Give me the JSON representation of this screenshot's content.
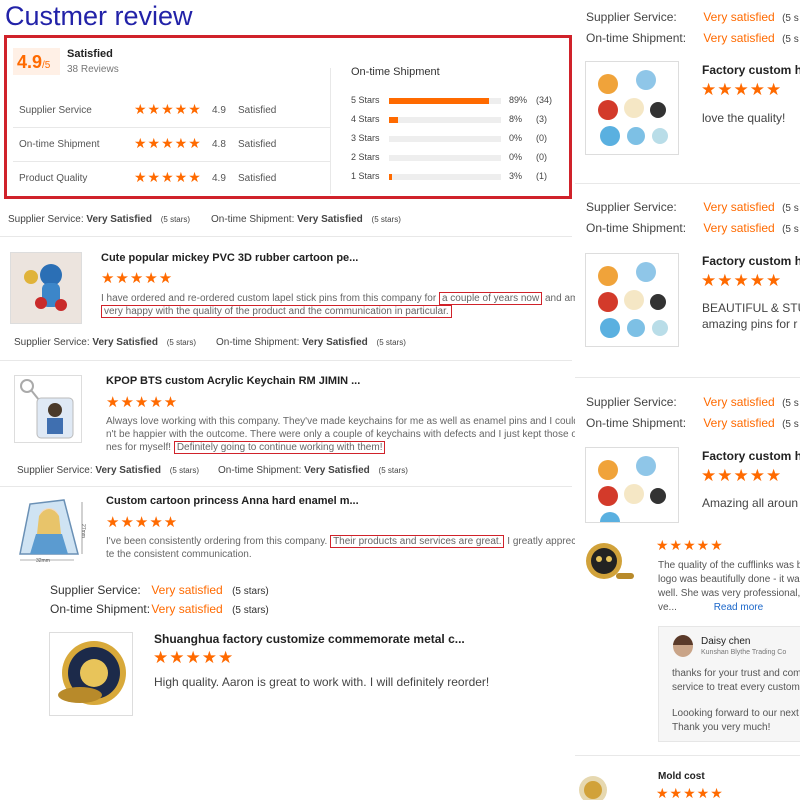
{
  "title": "Custmer review",
  "summary": {
    "score": "4.9",
    "score_suffix": "/5",
    "rating_word": "Satisfied",
    "reviews_count": "38 Reviews",
    "rows": [
      {
        "label": "Supplier Service",
        "stars": "★★★★★",
        "value": "4.9",
        "word": "Satisfied"
      },
      {
        "label": "On-time Shipment",
        "stars": "★★★★★",
        "value": "4.8",
        "word": "Satisfied"
      },
      {
        "label": "Product Quality",
        "stars": "★★★★★",
        "value": "4.9",
        "word": "Satisfied"
      }
    ],
    "dist_title": "On-time Shipment",
    "dist": [
      {
        "label": "5 Stars",
        "fraction": 0.89,
        "pct": "89%",
        "count": "(34)"
      },
      {
        "label": "4 Stars",
        "fraction": 0.08,
        "pct": "8%",
        "count": "(3)"
      },
      {
        "label": "3 Stars",
        "fraction": 0,
        "pct": "0%",
        "count": "(0)"
      },
      {
        "label": "2 Stars",
        "fraction": 0,
        "pct": "0%",
        "count": "(0)"
      },
      {
        "label": "1 Stars",
        "fraction": 0.03,
        "pct": "3%",
        "count": "(1)"
      }
    ]
  },
  "meta_small": {
    "supplier_label": "Supplier Service:",
    "supplier_value": "Very Satisfied",
    "shipment_label": "On-time Shipment:",
    "shipment_value": "Very Satisfied",
    "stars_note": "(5 stars)"
  },
  "stars5": "★★★★★",
  "reviews": [
    {
      "title": "Cute popular mickey PVC 3D rubber cartoon pe...",
      "text_a": "I have ordered and re-ordered custom lapel stick pins from this company for",
      "hl1": "a couple of years now",
      "text_b": "and am",
      "hl2": "very happy with the quality of the product and the communication in particular."
    },
    {
      "title": "KPOP BTS custom Acrylic Keychain RM JIMIN ...",
      "text_a": "Always love working with this company. They've made keychains for me as well as enamel pins and I could",
      "text_b": "n't be happier with the outcome. There were only a couple of keychains with defects and I just kept those o",
      "text_c": "nes for myself!",
      "hl1": "Definitely going to continue working with them!"
    },
    {
      "title": "Custom cartoon princess Anna hard enamel m...",
      "text_a": "I've been consistently ordering from this company.",
      "hl1": "Their products and services are great.",
      "text_b": "I greatly apprecia",
      "text_c": "te the consistent communication.",
      "dim_w": "32mm",
      "dim_h": "27mm"
    }
  ],
  "big_review": {
    "supplier_label": "Supplier Service:",
    "supplier_value": "Very satisfied",
    "shipment_label": "On-time Shipment:",
    "shipment_value": "Very satisfied",
    "stars_note": "(5 stars)",
    "title": "Shuanghua factory customize commemorate metal c...",
    "text": "High quality.  Aaron is great to work with.  I will definitely reorder!"
  },
  "right_reviews": [
    {
      "supplier_label": "Supplier Service:",
      "supplier_value": "Very satisfied",
      "note": "(5 s",
      "shipment_label": "On-time Shipment:",
      "shipment_value": "Very satisfied",
      "title": "Factory custom hi",
      "text": "love the quality!"
    },
    {
      "supplier_label": "Supplier Service:",
      "supplier_value": "Very satisfied",
      "note": "(5 s",
      "shipment_label": "On-time Shipment:",
      "shipment_value": "Very satisfied",
      "title": "Factory custom hi",
      "text": "BEAUTIFUL & STU",
      "text2": "amazing pins for r"
    },
    {
      "supplier_label": "Supplier Service:",
      "supplier_value": "Very satisfied",
      "note": "(5 s",
      "shipment_label": "On-time Shipment:",
      "shipment_value": "Very satisfied",
      "title": "Factory custom hi",
      "text": "Amazing all aroun"
    }
  ],
  "cufflinks": {
    "l1": "The quality of the cufflinks was b",
    "l2": "logo was beautifully done - it was",
    "l3": "well. She was very professional, c",
    "l4": "ve...",
    "read_more": "Read more"
  },
  "reply": {
    "name": "Daisy chen",
    "company": "Kunshan Blythe Trading Co",
    "l1": "thanks for your trust and com",
    "l2": "service to treat every custome",
    "l3": "Loooking forward to our next c",
    "l4": "Thank you very much!"
  },
  "mold": {
    "title": "Mold cost"
  },
  "colors": {
    "accent": "#ff6a00",
    "title": "#2222a8",
    "highlight": "#d0222a",
    "link": "#1a66c9"
  }
}
